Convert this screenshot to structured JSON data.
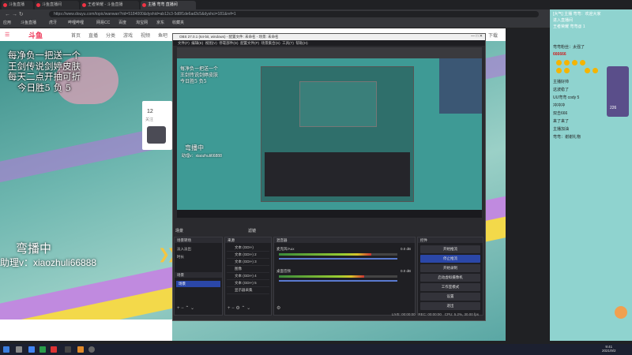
{
  "browser": {
    "tabs": [
      "斗鱼直播",
      "斗鱼直播间",
      "王者荣耀 - 斗鱼直播",
      "主播 弯弯 直播间"
    ],
    "url": "https://www.douyu.com/topic/wanwan?rid=5184000&dyshid=ab12c3-5d8f1de6ad3c5&dyshci=181&ref=1",
    "bookmarks": [
      "应用",
      "斗鱼直播",
      "虎牙",
      "哔哩哔哩",
      "网易CC",
      "百度",
      "淘宝网",
      "京东",
      "收藏夹"
    ]
  },
  "site": {
    "logo": "斗鱼",
    "nav": [
      "首页",
      "直播",
      "分类",
      "游戏",
      "视频",
      "鱼吧",
      "下载",
      "更多"
    ]
  },
  "overlay": {
    "lines": [
      "每净负一把送一个",
      "王剑传说剑婷皮肤",
      "每天二点开抽可折",
      "今日胜5 负 5"
    ],
    "status": "弯播中",
    "assistant": "助理v：xiaozhuli66888"
  },
  "room_card": {
    "count": "12",
    "label": "关注"
  },
  "chat": {
    "lines": [
      "[大气] 主播 弯弯：欢迎大家",
      "进入直播间",
      "王者荣耀 弯弯@ 1",
      "弯弯粉丝：太强了",
      "666666",
      "主播好帅",
      "这波稳了",
      "UU弯弯 cody 5",
      "冲冲冲",
      "双击666",
      "来了来了",
      "主播加油",
      "弯弯：谢谢礼物"
    ],
    "level": "226"
  },
  "obs": {
    "title": "OBS 27.0.1 (64-bit, windows) - 配置文件: 未命名 - 场景: 未命名",
    "menu": [
      "文件(F)",
      "编辑(E)",
      "视图(V)",
      "停靠部件(D)",
      "配置文件(P)",
      "场景集合(S)",
      "工具(T)",
      "帮助(H)"
    ],
    "preview_overlay": [
      "每净负一把送一个",
      "王剑传说剑婷皮肤",
      "今日胜5 负5"
    ],
    "preview_status": "弯播中",
    "preview_assistant": "助理v：xiaozhuli66888",
    "tabs": [
      "场景",
      "滤镜"
    ],
    "docks": {
      "scenes": {
        "title": "场景转场",
        "items": [
          "淡入淡出",
          "时长"
        ],
        "list_title": "场景",
        "list_items": [
          "场景"
        ]
      },
      "sources": {
        "title": "来源",
        "items": [
          "文本 (GDI+)",
          "文本 (GDI+) 2",
          "文本 (GDI+) 3",
          "图像",
          "文本 (GDI+) 4",
          "文本 (GDI+) 5",
          "显示器采集"
        ]
      },
      "mixer": {
        "title": "混音器",
        "channels": [
          {
            "name": "麦克风/Aux",
            "db": "0.0 dB",
            "level": 0.78
          },
          {
            "name": "桌面音频",
            "db": "0.0 dB",
            "level": 0.72
          }
        ]
      },
      "controls": {
        "title": "控件",
        "buttons": [
          "开始推流",
          "停止推流",
          "开始录制",
          "启动虚拟摄像机",
          "工作室模式",
          "设置",
          "退出"
        ]
      }
    },
    "status": [
      "LIVE: 00:00:00",
      "REC: 00:00:00",
      "CPU: 5.2%, 30.00 fps"
    ]
  },
  "taskbar": {
    "time": "9:41",
    "date": "2021/9/2"
  }
}
